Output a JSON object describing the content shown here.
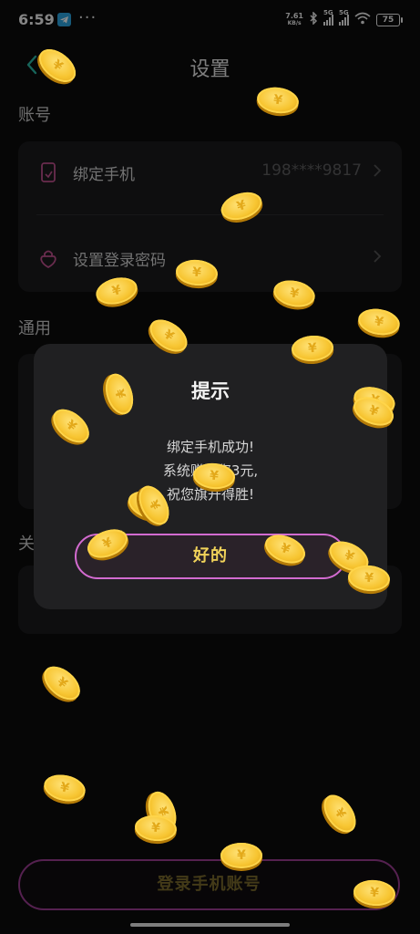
{
  "status_bar": {
    "time": "6:59",
    "net_speed_value": "7.61",
    "net_speed_unit": "KB/s",
    "signal1_label": "5G",
    "signal2_label": "5G",
    "battery": "75"
  },
  "header": {
    "title": "设置"
  },
  "account": {
    "section_title": "账号",
    "bind_phone_label": "绑定手机",
    "bind_phone_value": "198****9817",
    "login_password_label": "设置登录密码"
  },
  "general": {
    "section_title": "通用"
  },
  "about": {
    "section_title": "关"
  },
  "footer": {
    "login_button": "登录手机账号"
  },
  "dialog": {
    "title": "提示",
    "message_line1": "绑定手机成功!",
    "message_line2": "系统赠送您3元,",
    "message_line3": "祝您旗开得胜!",
    "ok_button": "好的"
  },
  "colors": {
    "accent": "#d36bd0",
    "coin": "#f7c531",
    "button_text": "#f1d35a"
  }
}
